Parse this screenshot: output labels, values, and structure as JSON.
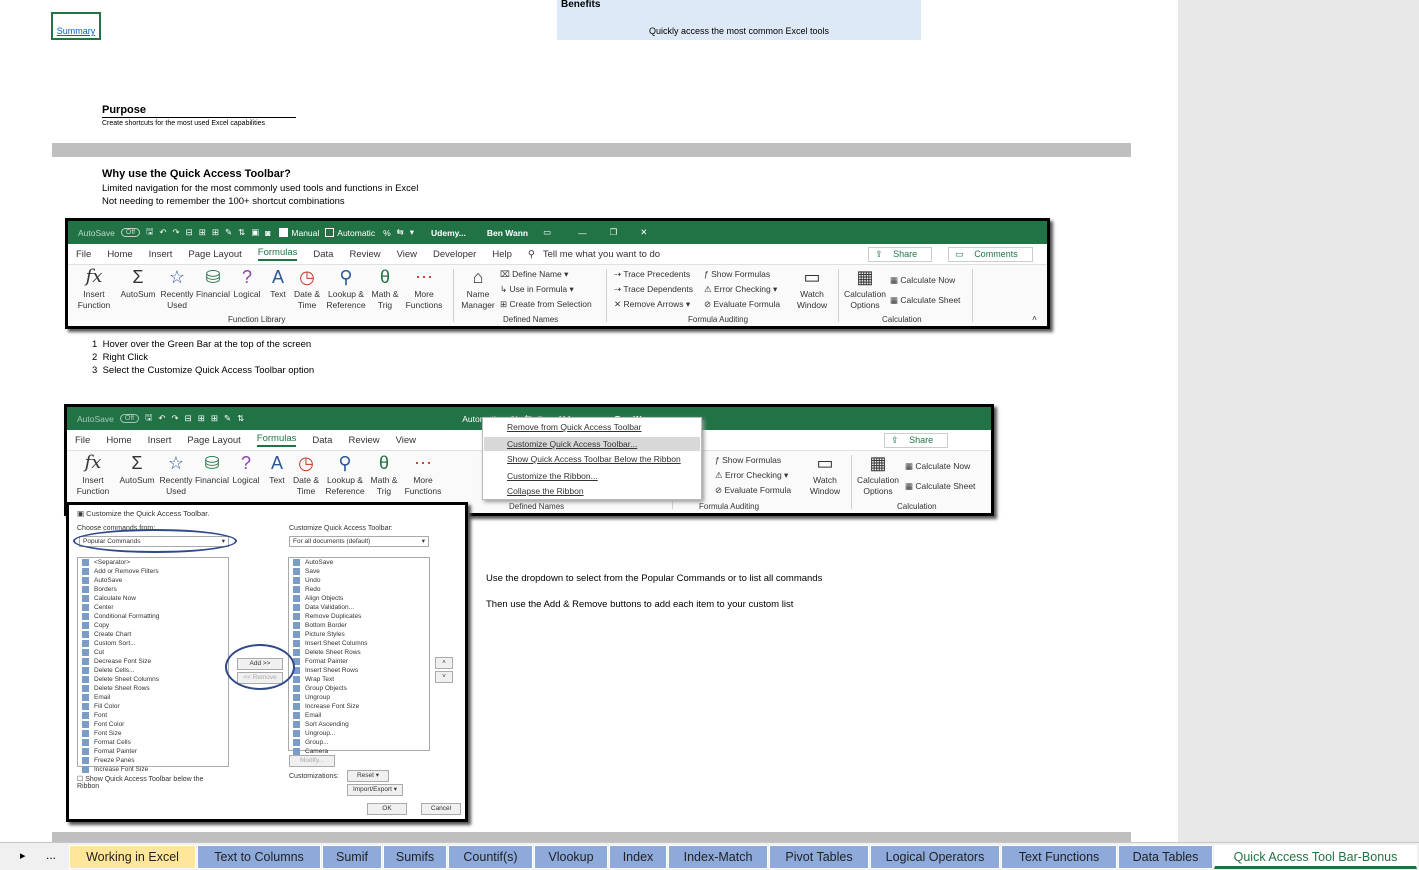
{
  "summary_link": "Summary",
  "benefits": {
    "title": "Benefits",
    "subtitle": "Quickly access the most common Excel tools"
  },
  "purpose": {
    "title": "Purpose",
    "subtitle": "Create shortcuts for the most used Excel capabilities"
  },
  "why": {
    "title": "Why use the Quick Access Toolbar?",
    "lines": [
      "Limited navigation for the most commonly used tools and functions in Excel",
      "Not needing to remember the 100+ shortcut combinations"
    ]
  },
  "steps": [
    {
      "num": "1",
      "text": "Hover over the Green Bar at the top of the screen"
    },
    {
      "num": "2",
      "text": "Right Click"
    },
    {
      "num": "3",
      "text": "Select the Customize Quick Access Toolbar option"
    }
  ],
  "instructions": [
    "Use the dropdown to select from the Popular Commands or to list all commands",
    "Then use the Add & Remove buttons to add each item to your custom list"
  ],
  "ribbon": {
    "autosave": "AutoSave",
    "autosave_state": "Off",
    "manual": "Manual",
    "automatic": "Automatic",
    "app": "Udemy...",
    "user": "Ben Wann",
    "tabs": [
      "File",
      "Home",
      "Insert",
      "Page Layout",
      "Formulas",
      "Data",
      "Review",
      "View",
      "Developer",
      "Help"
    ],
    "tell_me": "Tell me what you want to do",
    "share": "Share",
    "comments": "Comments",
    "buttons": {
      "insert_fn": [
        "Insert",
        "Function"
      ],
      "autosum": "AutoSum",
      "recent": [
        "Recently",
        "Used"
      ],
      "financial": "Financial",
      "logical": "Logical",
      "text": "Text",
      "datetime": [
        "Date &",
        "Time"
      ],
      "lookup": [
        "Lookup &",
        "Reference"
      ],
      "math": [
        "Math &",
        "Trig"
      ],
      "more": [
        "More",
        "Functions"
      ],
      "name_mgr": [
        "Name",
        "Manager"
      ],
      "define_name": "Define Name",
      "use_in_formula": "Use in Formula",
      "create_sel": "Create from Selection",
      "trace_prec": "Trace Precedents",
      "trace_dep": "Trace Dependents",
      "remove_arrows": "Remove Arrows",
      "show_formulas": "Show Formulas",
      "error_check": "Error Checking",
      "eval_formula": "Evaluate Formula",
      "watch": [
        "Watch",
        "Window"
      ],
      "calc_opts": [
        "Calculation",
        "Options"
      ],
      "calc_now": "Calculate Now",
      "calc_sheet": "Calculate Sheet"
    },
    "groups": [
      "Function Library",
      "Defined Names",
      "Formula Auditing",
      "Calculation"
    ]
  },
  "context_menu": [
    "Remove from Quick Access Toolbar",
    "Customize Quick Access Toolbar...",
    "Show Quick Access Toolbar Below the Ribbon",
    "Customize the Ribbon...",
    "Collapse the Ribbon"
  ],
  "dialog": {
    "title": "Customize the Quick Access Toolbar.",
    "choose_label": "Choose commands from:",
    "choose_value": "Popular Commands",
    "customize_label": "Customize Quick Access Toolbar:",
    "customize_value": "For all documents (default)",
    "left_items": [
      "<Separator>",
      "Add or Remove Filters",
      "AutoSave",
      "Borders",
      "Calculate Now",
      "Center",
      "Conditional Formatting",
      "Copy",
      "Create Chart",
      "Custom Sort...",
      "Cut",
      "Decrease Font Size",
      "Delete Cells...",
      "Delete Sheet Columns",
      "Delete Sheet Rows",
      "Email",
      "Fill Color",
      "Font",
      "Font Color",
      "Font Size",
      "Format Cells",
      "Format Painter",
      "Freeze Panes",
      "Increase Font Size"
    ],
    "right_items": [
      "AutoSave",
      "Save",
      "Undo",
      "Redo",
      "Align Objects",
      "Data Validation...",
      "Remove Duplicates",
      "Bottom Border",
      "Picture Styles",
      "Insert Sheet Columns",
      "Delete Sheet Rows",
      "Format Painter",
      "Insert Sheet Rows",
      "Wrap Text",
      "Group Objects",
      "Ungroup",
      "Increase Font Size",
      "Email",
      "Sort Ascending",
      "Ungroup...",
      "Group...",
      "Camera"
    ],
    "add": "Add >>",
    "remove": "<< Remove",
    "modify": "Modify...",
    "customizations": "Customizations:",
    "reset": "Reset",
    "import_export": "Import/Export",
    "show_below": "Show Quick Access Toolbar below the Ribbon",
    "ok": "OK",
    "cancel": "Cancel"
  },
  "sheet_tabs": [
    "Working in Excel",
    "Text to Columns",
    "Sumif",
    "Sumifs",
    "Countif(s)",
    "Vlookup",
    "Index",
    "Index-Match",
    "Pivot Tables",
    "Logical Operators",
    "Text Functions",
    "Data Tables",
    "Quick Access Tool Bar-Bonus"
  ],
  "tab_nav": {
    "next": "▸",
    "more": "..."
  },
  "colors": {
    "excel_green": "#217346",
    "tab_blue": "#8eaadb",
    "tab_yellow": "#ffe699",
    "benefits_bg": "#dde9f6"
  }
}
